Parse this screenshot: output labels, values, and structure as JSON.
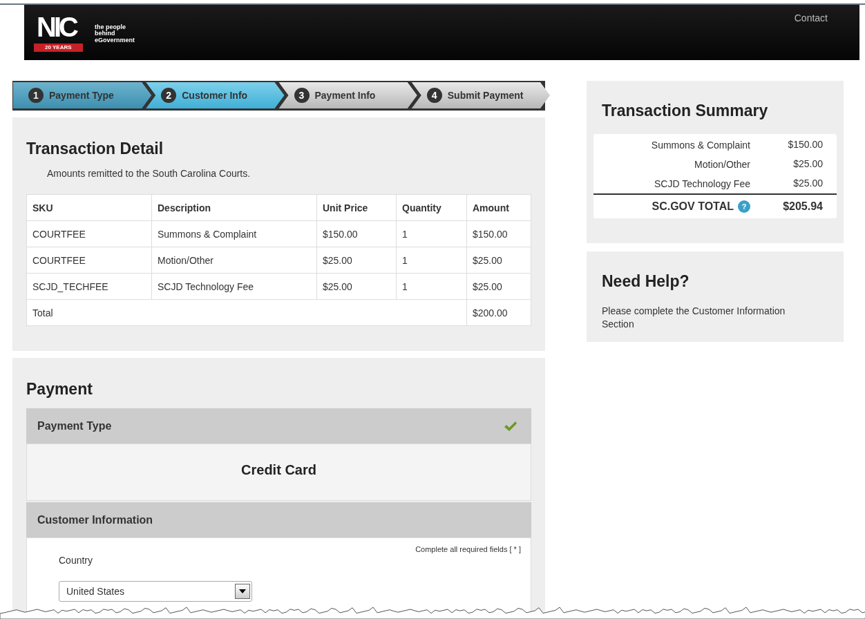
{
  "header": {
    "logo": {
      "mark": "NIC",
      "tagline": [
        "the people",
        "behind",
        "eGovernment"
      ],
      "banner": "20 YEARS"
    },
    "nav": [
      "Contact"
    ]
  },
  "steps": [
    {
      "number": "1",
      "label": "Payment Type",
      "completed": true,
      "selected": false
    },
    {
      "number": "2",
      "label": "Customer Info",
      "completed": false,
      "selected": true
    },
    {
      "number": "3",
      "label": "Payment Info",
      "completed": false,
      "selected": false
    },
    {
      "number": "4",
      "label": "Submit Payment",
      "completed": false,
      "selected": false
    }
  ],
  "transaction_detail": {
    "title": "Transaction Detail",
    "note": "Amounts remitted to the South Carolina Courts.",
    "columns": [
      "SKU",
      "Description",
      "Unit Price",
      "Quantity",
      "Amount"
    ],
    "rows": [
      [
        "COURTFEE",
        "Summons & Complaint",
        "$150.00",
        "1",
        "$150.00"
      ],
      [
        "COURTFEE",
        "Motion/Other",
        "$25.00",
        "1",
        "$25.00"
      ],
      [
        "SCJD_TECHFEE",
        "SCJD Technology Fee",
        "$25.00",
        "1",
        "$25.00"
      ]
    ],
    "total": {
      "label": "Total",
      "amount": "$200.00"
    }
  },
  "payment": {
    "title": "Payment",
    "sections": [
      {
        "title": "Payment Type",
        "complete": true,
        "value": "Credit Card"
      },
      {
        "title": "Customer Information",
        "complete": false,
        "required_note": "Complete all required fields [ * ]",
        "fields": [
          {
            "label": "Country",
            "value": "United States"
          }
        ]
      }
    ]
  },
  "summary": {
    "title": "Transaction Summary",
    "items": [
      {
        "name": "Summons & Complaint",
        "amount": "$150.00"
      },
      {
        "name": "Motion/Other",
        "amount": "$25.00"
      },
      {
        "name": "SCJD Technology Fee",
        "amount": "$25.00"
      }
    ],
    "total": {
      "label": "SC.GOV TOTAL",
      "help": "?",
      "amount": "$205.94"
    }
  },
  "help": {
    "title": "Need Help?",
    "text": "Please complete the Customer Information Section"
  }
}
